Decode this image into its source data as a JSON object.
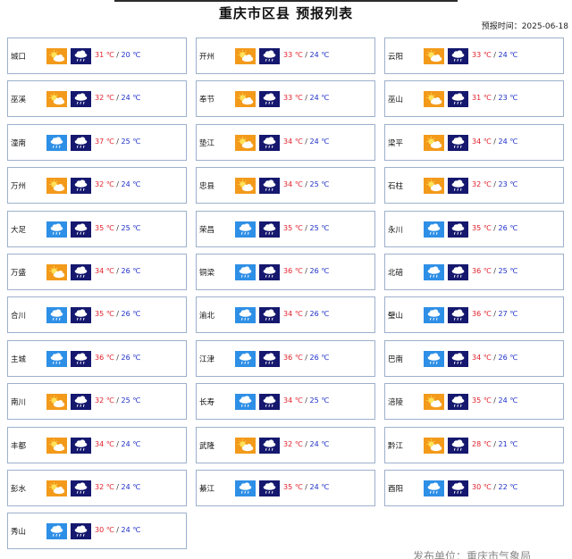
{
  "header": {
    "title": "重庆市区县  预报列表",
    "forecast_time": "预报时间：2025-06-18"
  },
  "footer": {
    "text": "发布单位：重庆市气象局"
  },
  "colors": {
    "sunny_cloudy_bg": "#f39a1b",
    "rain_bg": "#2e8fe6",
    "night_bg": "#15186e",
    "max_temp": "#e0202a",
    "min_temp": "#1c2ec8",
    "card_border": "#9db0cc"
  },
  "cities": [
    {
      "name": "城口",
      "day_icon": "sunny-cloudy-icon",
      "night_icon": "night-rain-icon",
      "tmax": "31 ℃",
      "tmin": "20 ℃"
    },
    {
      "name": "开州",
      "day_icon": "sunny-cloudy-icon",
      "night_icon": "night-rain-icon",
      "tmax": "33 ℃",
      "tmin": "24 ℃"
    },
    {
      "name": "云阳",
      "day_icon": "sunny-cloudy-icon",
      "night_icon": "night-rain-icon",
      "tmax": "33 ℃",
      "tmin": "24 ℃"
    },
    {
      "name": "巫溪",
      "day_icon": "sunny-cloudy-icon",
      "night_icon": "night-rain-icon",
      "tmax": "32 ℃",
      "tmin": "24 ℃"
    },
    {
      "name": "奉节",
      "day_icon": "sunny-cloudy-icon",
      "night_icon": "night-rain-icon",
      "tmax": "33 ℃",
      "tmin": "24 ℃"
    },
    {
      "name": "巫山",
      "day_icon": "sunny-cloudy-icon",
      "night_icon": "night-rain-icon",
      "tmax": "31 ℃",
      "tmin": "23 ℃"
    },
    {
      "name": "潼南",
      "day_icon": "rain-icon",
      "night_icon": "night-rain-icon",
      "tmax": "37 ℃",
      "tmin": "25 ℃"
    },
    {
      "name": "垫江",
      "day_icon": "sunny-cloudy-icon",
      "night_icon": "night-rain-icon",
      "tmax": "34 ℃",
      "tmin": "24 ℃"
    },
    {
      "name": "梁平",
      "day_icon": "sunny-cloudy-icon",
      "night_icon": "night-rain-icon",
      "tmax": "34 ℃",
      "tmin": "24 ℃"
    },
    {
      "name": "万州",
      "day_icon": "sunny-cloudy-icon",
      "night_icon": "night-rain-icon",
      "tmax": "32 ℃",
      "tmin": "24 ℃"
    },
    {
      "name": "忠县",
      "day_icon": "sunny-cloudy-icon",
      "night_icon": "night-rain-icon",
      "tmax": "34 ℃",
      "tmin": "25 ℃"
    },
    {
      "name": "石柱",
      "day_icon": "sunny-cloudy-icon",
      "night_icon": "night-rain-icon",
      "tmax": "32 ℃",
      "tmin": "23 ℃"
    },
    {
      "name": "大足",
      "day_icon": "rain-icon",
      "night_icon": "night-rain-icon",
      "tmax": "35 ℃",
      "tmin": "25 ℃"
    },
    {
      "name": "荣昌",
      "day_icon": "rain-icon",
      "night_icon": "night-rain-icon",
      "tmax": "35 ℃",
      "tmin": "25 ℃"
    },
    {
      "name": "永川",
      "day_icon": "rain-icon",
      "night_icon": "night-rain-icon",
      "tmax": "35 ℃",
      "tmin": "26 ℃"
    },
    {
      "name": "万盛",
      "day_icon": "sunny-cloudy-icon",
      "night_icon": "night-rain-icon",
      "tmax": "34 ℃",
      "tmin": "26 ℃"
    },
    {
      "name": "铜梁",
      "day_icon": "rain-icon",
      "night_icon": "night-rain-icon",
      "tmax": "36 ℃",
      "tmin": "26 ℃"
    },
    {
      "name": "北碚",
      "day_icon": "rain-icon",
      "night_icon": "night-rain-icon",
      "tmax": "36 ℃",
      "tmin": "25 ℃"
    },
    {
      "name": "合川",
      "day_icon": "rain-icon",
      "night_icon": "night-rain-icon",
      "tmax": "35 ℃",
      "tmin": "26 ℃"
    },
    {
      "name": "渝北",
      "day_icon": "rain-icon",
      "night_icon": "night-rain-icon",
      "tmax": "34 ℃",
      "tmin": "26 ℃"
    },
    {
      "name": "璧山",
      "day_icon": "rain-icon",
      "night_icon": "night-rain-icon",
      "tmax": "36 ℃",
      "tmin": "27 ℃"
    },
    {
      "name": "主城",
      "day_icon": "rain-icon",
      "night_icon": "night-rain-icon",
      "tmax": "36 ℃",
      "tmin": "26 ℃"
    },
    {
      "name": "江津",
      "day_icon": "rain-icon",
      "night_icon": "night-rain-icon",
      "tmax": "36 ℃",
      "tmin": "26 ℃"
    },
    {
      "name": "巴南",
      "day_icon": "rain-icon",
      "night_icon": "night-rain-icon",
      "tmax": "34 ℃",
      "tmin": "26 ℃"
    },
    {
      "name": "南川",
      "day_icon": "sunny-cloudy-icon",
      "night_icon": "night-rain-icon",
      "tmax": "32 ℃",
      "tmin": "25 ℃"
    },
    {
      "name": "长寿",
      "day_icon": "rain-icon",
      "night_icon": "night-rain-icon",
      "tmax": "34 ℃",
      "tmin": "25 ℃"
    },
    {
      "name": "涪陵",
      "day_icon": "sunny-cloudy-icon",
      "night_icon": "night-rain-icon",
      "tmax": "35 ℃",
      "tmin": "24 ℃"
    },
    {
      "name": "丰都",
      "day_icon": "sunny-cloudy-icon",
      "night_icon": "night-rain-icon",
      "tmax": "34 ℃",
      "tmin": "24 ℃"
    },
    {
      "name": "武隆",
      "day_icon": "sunny-cloudy-icon",
      "night_icon": "night-rain-icon",
      "tmax": "32 ℃",
      "tmin": "24 ℃"
    },
    {
      "name": "黔江",
      "day_icon": "sunny-cloudy-icon",
      "night_icon": "night-rain-icon",
      "tmax": "28 ℃",
      "tmin": "21 ℃"
    },
    {
      "name": "彭水",
      "day_icon": "sunny-cloudy-icon",
      "night_icon": "night-rain-icon",
      "tmax": "32 ℃",
      "tmin": "24 ℃"
    },
    {
      "name": "綦江",
      "day_icon": "rain-icon",
      "night_icon": "night-rain-icon",
      "tmax": "35 ℃",
      "tmin": "24 ℃"
    },
    {
      "name": "酉阳",
      "day_icon": "rain-icon",
      "night_icon": "night-rain-icon",
      "tmax": "30 ℃",
      "tmin": "22 ℃"
    },
    {
      "name": "秀山",
      "day_icon": "rain-icon",
      "night_icon": "night-rain-icon",
      "tmax": "30 ℃",
      "tmin": "24 ℃"
    }
  ]
}
